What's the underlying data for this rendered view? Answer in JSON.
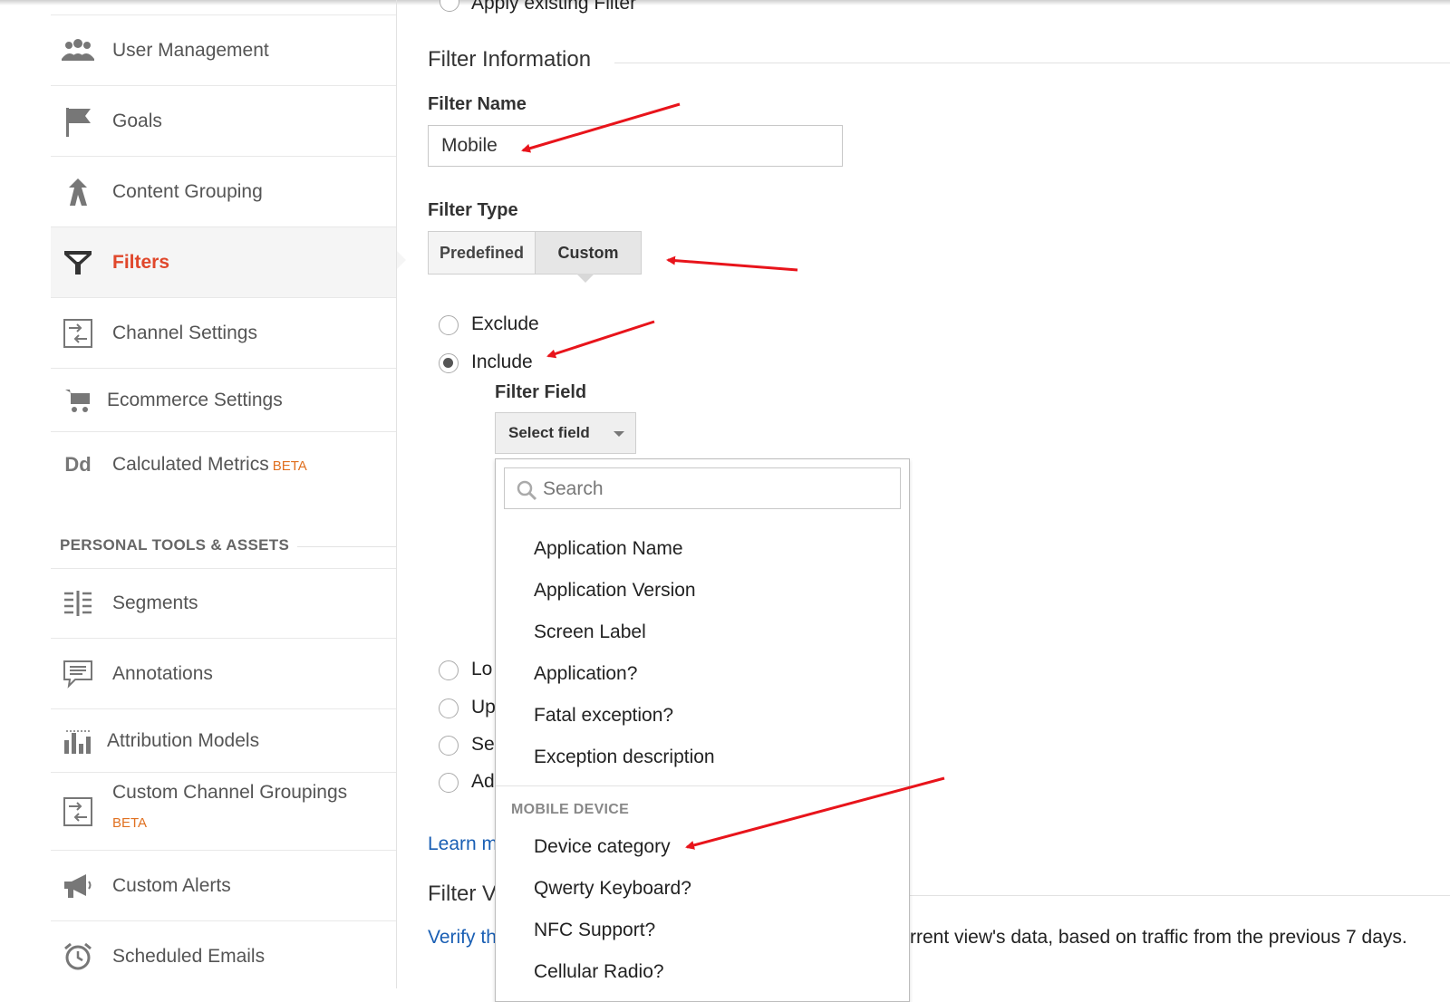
{
  "sidebar": {
    "items": [
      {
        "label": "User Management",
        "icon": "users-icon"
      },
      {
        "label": "Goals",
        "icon": "flag-icon"
      },
      {
        "label": "Content Grouping",
        "icon": "content-grouping-icon"
      },
      {
        "label": "Filters",
        "icon": "filter-icon",
        "active": true
      },
      {
        "label": "Channel Settings",
        "icon": "channel-settings-icon"
      },
      {
        "label": "Ecommerce Settings",
        "icon": "cart-icon"
      },
      {
        "label": "Calculated Metrics",
        "badge": "BETA",
        "icon": "calculated-metrics-icon",
        "icon_text": "Dd"
      }
    ],
    "section_title": "PERSONAL TOOLS & ASSETS",
    "tools": [
      {
        "label": "Segments",
        "icon": "segments-icon"
      },
      {
        "label": "Annotations",
        "icon": "annotations-icon"
      },
      {
        "label": "Attribution Models",
        "icon": "attribution-icon"
      },
      {
        "label": "Custom Channel Groupings",
        "badge": "BETA",
        "icon": "channel-groupings-icon"
      },
      {
        "label": "Custom Alerts",
        "icon": "megaphone-icon"
      },
      {
        "label": "Scheduled Emails",
        "icon": "alarm-clock-icon"
      }
    ]
  },
  "main": {
    "top_radio_label": "Apply existing Filter",
    "filter_info_title": "Filter Information",
    "filter_name_label": "Filter Name",
    "filter_name_value": "Mobile",
    "filter_type_label": "Filter Type",
    "filter_type_options": [
      "Predefined",
      "Custom"
    ],
    "filter_type_selected": "Custom",
    "radio_exclude": "Exclude",
    "radio_include": "Include",
    "radio_selected": "Include",
    "filter_field_label": "Filter Field",
    "select_field_label": "Select field",
    "hidden_radio_labels": [
      "Lo",
      "Up",
      "Se",
      "Ad"
    ],
    "learn_more_text": "Learn m",
    "filter_verification_title": "Filter V",
    "verify_link_text": "Verify th",
    "verify_rest_text": "rrent view's data, based on traffic from the previous 7 days."
  },
  "dropdown": {
    "search_placeholder": "Search",
    "items": [
      "Application Name",
      "Application Version",
      "Screen Label",
      "Application?",
      "Fatal exception?",
      "Exception description"
    ],
    "group_title": "MOBILE DEVICE",
    "group_items": [
      "Device category",
      "Qwerty Keyboard?",
      "NFC Support?",
      "Cellular Radio?"
    ]
  },
  "colors": {
    "active": "#e0472b",
    "beta": "#e07020",
    "link": "#1a5fb4",
    "annotation_arrow": "#e8141b"
  }
}
